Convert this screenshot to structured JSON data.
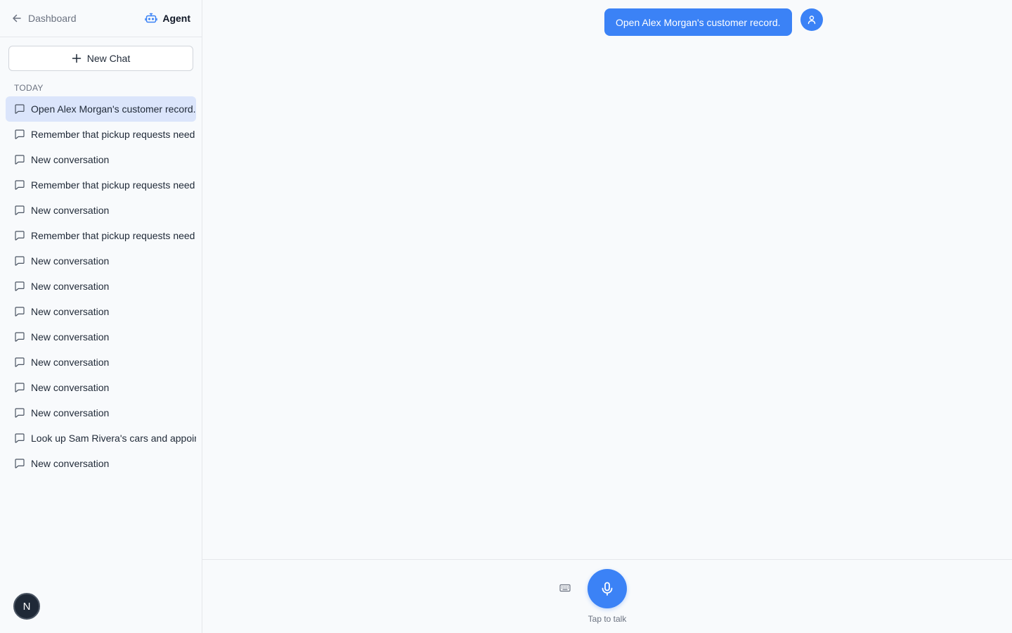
{
  "sidebar": {
    "back_label": "Dashboard",
    "agent_label": "Agent",
    "new_chat_label": "New Chat",
    "section_label": "TODAY",
    "conversations": [
      {
        "label": "Open Alex Morgan's customer record.",
        "active": true
      },
      {
        "label": "Remember that pickup requests need"
      },
      {
        "label": "New conversation"
      },
      {
        "label": "Remember that pickup requests need"
      },
      {
        "label": "New conversation"
      },
      {
        "label": "Remember that pickup requests need"
      },
      {
        "label": "New conversation"
      },
      {
        "label": "New conversation"
      },
      {
        "label": "New conversation"
      },
      {
        "label": "New conversation"
      },
      {
        "label": "New conversation"
      },
      {
        "label": "New conversation"
      },
      {
        "label": "New conversation"
      },
      {
        "label": "Look up Sam Rivera's cars and appointments"
      },
      {
        "label": "New conversation"
      }
    ],
    "user_initial": "N"
  },
  "chat": {
    "user_message": "Open Alex Morgan's customer record."
  },
  "footer": {
    "tap_label": "Tap to talk"
  },
  "colors": {
    "accent": "#3b82f6",
    "active_item": "#dbe5fb"
  }
}
